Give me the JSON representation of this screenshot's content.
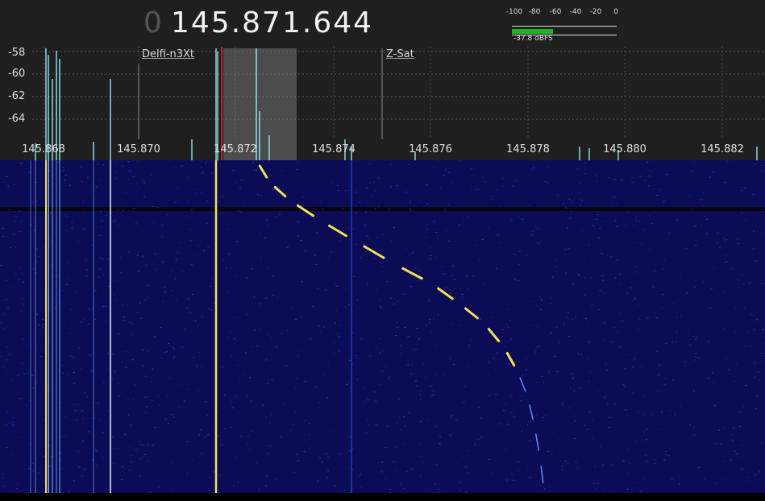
{
  "header": {
    "freq_prefix": "0",
    "frequency": "145.871.644"
  },
  "level_meter": {
    "scale": [
      "-100",
      "-80",
      "-60",
      "-40",
      "-20",
      "0"
    ],
    "readout": "-37.8 dBFS",
    "level_dbfs": -37.8,
    "fill_color": "#22b322"
  },
  "spectrum": {
    "db_labels": [
      "-58",
      "-60",
      "-62",
      "-64"
    ],
    "freq_labels": [
      "145.868",
      "145.870",
      "145.872",
      "145.874",
      "145.876",
      "145.878",
      "145.880",
      "145.882"
    ],
    "bookmarks": [
      "Delfi-n3Xt",
      "Z-Sat"
    ],
    "trace_color": "#9ff3ff"
  },
  "waterfall": {
    "background_color": "#0b0c55",
    "signal_color": "#f4e05a"
  }
}
